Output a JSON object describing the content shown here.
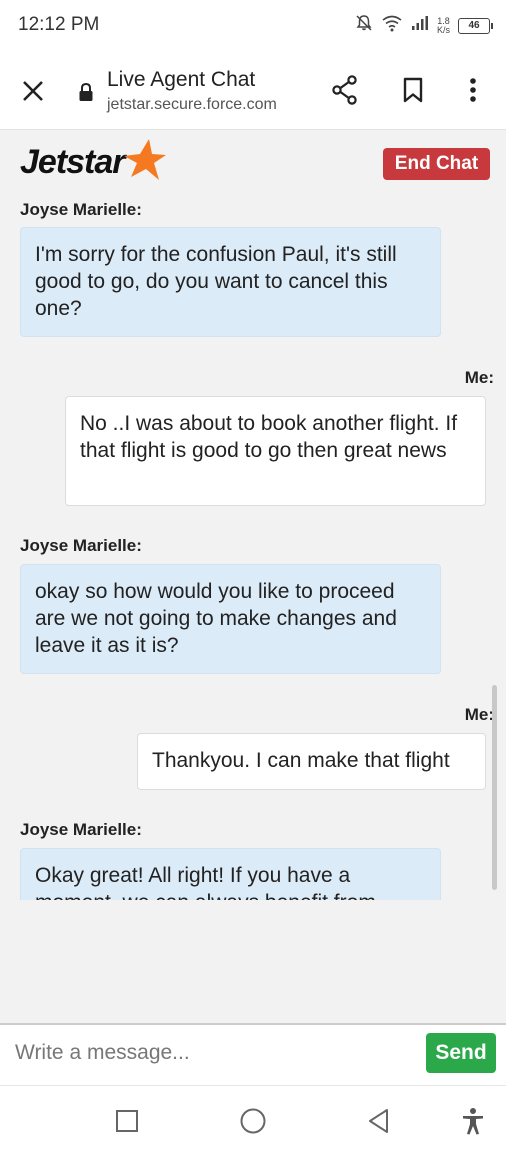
{
  "status_bar": {
    "time": "12:12 PM",
    "net_speed_value": "1.8",
    "net_speed_unit": "K/s",
    "battery": "46"
  },
  "browser": {
    "title": "Live Agent Chat",
    "url": "jetstar.secure.force.com"
  },
  "header": {
    "logo_text": "Jetstar",
    "end_chat_label": "End Chat"
  },
  "messages": [
    {
      "sender": "Joyse Marielle:",
      "role": "agent",
      "text": "I'm sorry for the confusion Paul, it's still good to go, do you want to cancel this one?"
    },
    {
      "sender": "Me:",
      "role": "me",
      "text": "No ..I was about to book another flight. If that flight is good to go then great news"
    },
    {
      "sender": "Joyse Marielle:",
      "role": "agent",
      "text": "okay so how would you like to proceed are we not going to make changes and leave it as it is?"
    },
    {
      "sender": "Me:",
      "role": "me",
      "text": "Thankyou. I can make that flight"
    },
    {
      "sender": "Joyse Marielle:",
      "role": "agent",
      "text": "Okay great! All right! If you have a moment, we can always benefit from"
    }
  ],
  "input": {
    "placeholder": "Write a message...",
    "value": "",
    "send_label": "Send"
  },
  "colors": {
    "brand_orange": "#f47920",
    "end_chat_red": "#c8393d",
    "send_green": "#2ba84a",
    "agent_bubble": "#dcebf8"
  }
}
